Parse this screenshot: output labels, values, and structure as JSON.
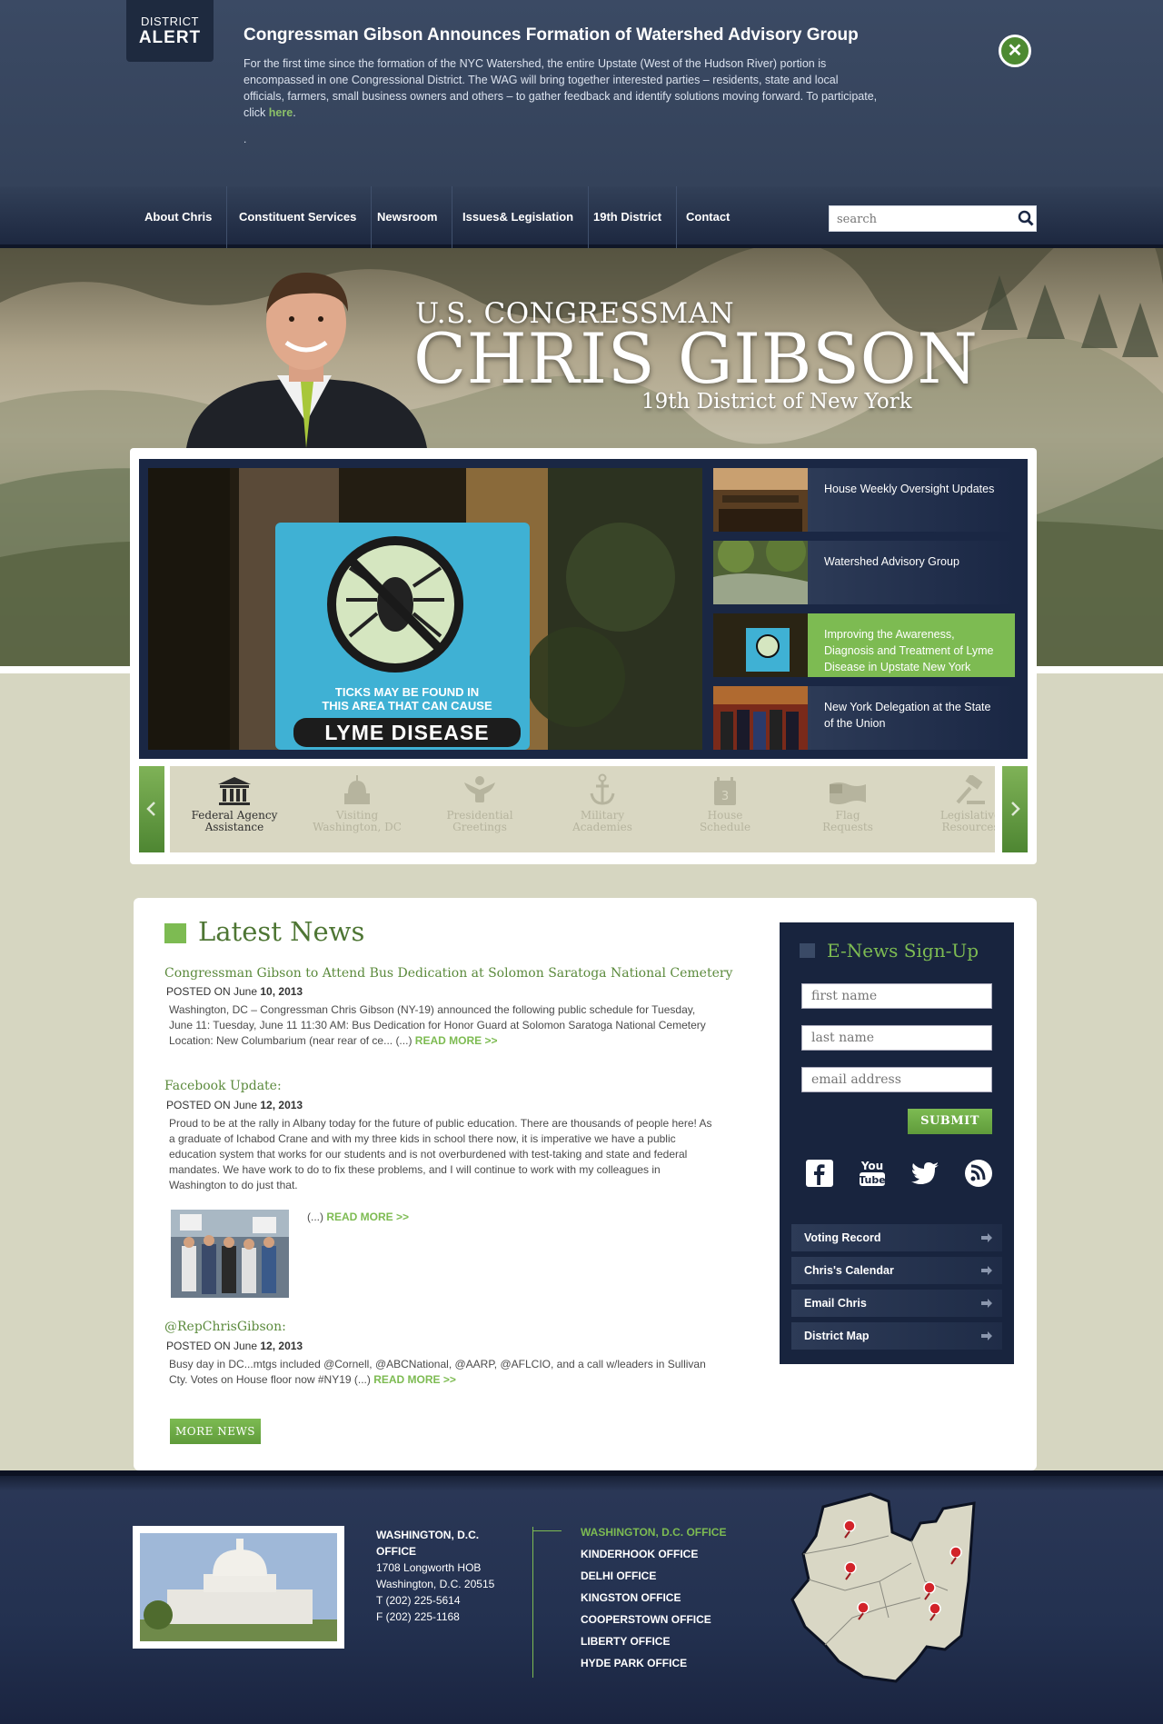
{
  "alert": {
    "badge_line1": "DISTRICT",
    "badge_line2": "ALERT",
    "title": "Congressman Gibson Announces Formation of Watershed Advisory Group",
    "body_lines": [
      "For the first time since the formation of the NYC Watershed, the entire Upstate (West of the Hudson River) portion is",
      "encompassed in one Congressional District.  The WAG will bring together interested parties – residents, state and local",
      "officials, farmers, small business owners and others – to gather feedback and identify solutions moving forward.  To participate,"
    ],
    "click_prefix": "click ",
    "link_text": "here",
    "link_suffix": ".",
    "dot": ".",
    "close_icon": "close-icon"
  },
  "nav": {
    "items": [
      "About Chris",
      "Constituent Services",
      "Newsroom",
      "Issues& Legislation",
      "19th District",
      "Contact"
    ],
    "search_placeholder": "search"
  },
  "hero": {
    "line1": "U.S. CONGRESSMAN",
    "line2": "CHRIS GIBSON",
    "line3": "19th District of New York"
  },
  "slider": {
    "sign_line1": "TICKS MAY BE FOUND IN",
    "sign_line2": "THIS AREA THAT CAN CAUSE",
    "sign_line3": "LYME DISEASE",
    "thumbs": [
      {
        "label": "House Weekly Oversight Updates",
        "active": false
      },
      {
        "label": "Watershed Advisory Group",
        "active": false
      },
      {
        "label": "Improving the Awareness, Diagnosis and Treatment of Lyme Disease in Upstate New York",
        "active": true
      },
      {
        "label": "New York Delegation at the State of the Union",
        "active": false
      }
    ]
  },
  "services": [
    {
      "line1": "Federal Agency",
      "line2": "Assistance",
      "icon": "building-icon",
      "active": true
    },
    {
      "line1": "Visiting",
      "line2": "Washington, DC",
      "icon": "capitol-icon",
      "active": false
    },
    {
      "line1": "Presidential",
      "line2": "Greetings",
      "icon": "eagle-seal-icon",
      "active": false
    },
    {
      "line1": "Military",
      "line2": "Academies",
      "icon": "anchor-icon",
      "active": false
    },
    {
      "line1": "House",
      "line2": "Schedule",
      "icon": "calendar-icon",
      "active": false
    },
    {
      "line1": "Flag",
      "line2": "Requests",
      "icon": "flag-icon",
      "active": false
    },
    {
      "line1": "Legislative",
      "line2": "Resources",
      "icon": "gavel-icon",
      "active": false
    }
  ],
  "news": {
    "heading": "Latest News",
    "posted_prefix": "POSTED ON June ",
    "items": [
      {
        "title": "Congressman Gibson to Attend Bus Dedication at Solomon Saratoga National Cemetery",
        "date": "10, 2013",
        "body_lines": [
          "Washington, DC – Congressman Chris Gibson (NY-19) announced the following public schedule for Tuesday,",
          "June 11: Tuesday, June 11 11:30 AM: Bus Dedication for Honor Guard at Solomon Saratoga National Cemetery",
          "Location: New Columbarium (near rear of ce... (...) "
        ]
      },
      {
        "title": "Facebook Update:",
        "date": "12, 2013",
        "body_lines": [
          "Proud to be at the rally in Albany today for the future of public education. There are thousands of people here! As",
          "a graduate of Ichabod Crane and with my three kids in school there now, it is imperative we have a public",
          "education system that works for our students and is not overburdened with test-taking and state and federal",
          "mandates. We have work to do to fix these problems, and I will continue to work with my colleagues in",
          "Washington to do just that."
        ]
      },
      {
        "title": "@RepChrisGibson:",
        "date": "12, 2013",
        "body_lines": [
          "Busy day in DC...mtgs included @Cornell, @ABCNational, @AARP, @AFLCIO, and a call w/leaders in Sullivan",
          "Cty. Votes on House floor now #NY19 (...) "
        ]
      }
    ],
    "ellipsis": "(...) ",
    "read_more": "READ MORE >>",
    "more_news": "MORE NEWS"
  },
  "enews": {
    "heading": "E-News Sign-Up",
    "first_name": "first name",
    "last_name": "last name",
    "email": "email address",
    "submit": "SUBMIT",
    "social": [
      "facebook-icon",
      "youtube-icon",
      "twitter-icon",
      "rss-icon"
    ],
    "links": [
      "Voting Record",
      "Chris's Calendar",
      "Email Chris",
      "District Map"
    ]
  },
  "footer": {
    "addr_h1": "WASHINGTON, D.C.",
    "addr_h2": "OFFICE",
    "addr_lines": [
      "1708 Longworth HOB",
      "Washington, D.C. 20515",
      "T (202) 225-5614",
      "F (202) 225-1168"
    ],
    "offices": [
      "WASHINGTON, D.C. OFFICE",
      "KINDERHOOK OFFICE",
      "DELHI OFFICE",
      "KINGSTON OFFICE",
      "COOPERSTOWN OFFICE",
      "LIBERTY OFFICE",
      "HYDE PARK OFFICE"
    ]
  },
  "colors": {
    "accent": "#7dbb52",
    "navy": "#1a2744",
    "alert_bg": "#3b4a64"
  }
}
